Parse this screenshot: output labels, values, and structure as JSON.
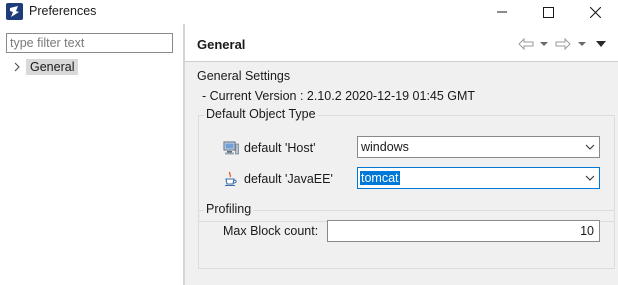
{
  "window": {
    "title": "Preferences",
    "app_icon": "app-logo-icon",
    "controls": [
      "minimize-icon",
      "maximize-icon",
      "close-icon"
    ]
  },
  "sidebar": {
    "filter_placeholder": "type filter text",
    "items": [
      {
        "label": "General",
        "expand_icon": "chevron-right-icon",
        "selected": true
      }
    ]
  },
  "page": {
    "title": "General",
    "nav_icons": [
      "back-arrow-icon",
      "back-dropdown-icon",
      "forward-arrow-icon",
      "forward-dropdown-icon",
      "view-menu-icon"
    ],
    "general_settings_label": "General Settings",
    "current_version": "- Current Version : 2.10.2 2020-12-19 01:45 GMT",
    "default_object_type": {
      "title": "Default Object Type",
      "rows": [
        {
          "icon": "host-computer-icon",
          "label": "default 'Host'",
          "value": "windows"
        },
        {
          "icon": "java-cup-icon",
          "label": "default 'JavaEE'",
          "value": "tomcat"
        }
      ]
    },
    "profiling": {
      "title": "Profiling",
      "max_block_label": "Max Block count:",
      "max_block_value": "10"
    }
  },
  "colors": {
    "selection": "#0078d7",
    "panel_bg": "#f0f0f0",
    "tree_selected_bg": "#d9d9d9"
  }
}
